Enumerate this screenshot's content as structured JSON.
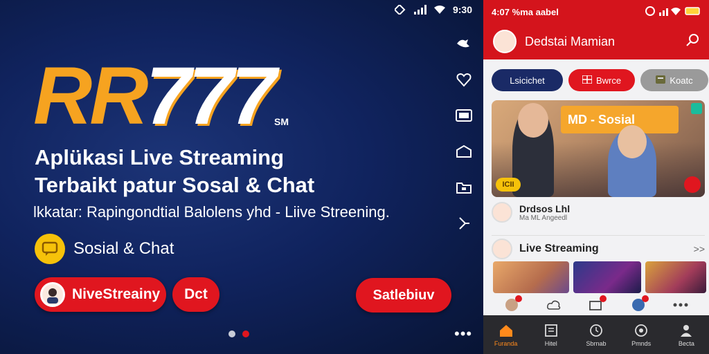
{
  "promo": {
    "status_time": "9:30",
    "logo_rr": "RR",
    "logo_sevens": "777",
    "logo_tag": "SM",
    "headline_1": "Aplükasi Live Streaming",
    "headline_2": "Terbaikt patur Sosal & Chat",
    "subline": "lkkatar: Rapingondtial Balolens yhd - Liive Streening.",
    "badge_label": "Sosial & Chat",
    "pill_1_label": "NiveStreainy",
    "pill_2_label": "Dct",
    "pill_3_label": "Satlebiuv",
    "carousel_dots": 2,
    "carousel_active": 1,
    "accent": "#e0161f",
    "brand_gold": "#f6a320"
  },
  "phone": {
    "status_left": "4:07  %ma aabel",
    "header_title": "Dedstai Mamian",
    "chips": [
      {
        "label": "Lsicichet"
      },
      {
        "label": "Bwrce"
      },
      {
        "label": "Koatc"
      }
    ],
    "hero_banner": "MD - Sosial",
    "hero_tag": "ICII",
    "row1_title": "Drdsos Lhl",
    "row1_sub": "Ma ML Angeedl",
    "row2_title": "Live Streaming",
    "row2_chevron": ">>",
    "nav": [
      {
        "label": "Furanda"
      },
      {
        "label": "Hitel"
      },
      {
        "label": "Sbrnab"
      },
      {
        "label": "Pmnds"
      },
      {
        "label": "Becta"
      }
    ],
    "primary": "#d4141c",
    "nav_active": "#ff8a1c"
  }
}
